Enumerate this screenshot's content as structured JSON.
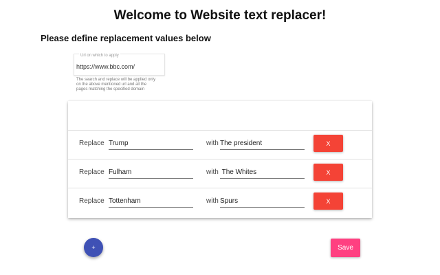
{
  "header": {
    "title": "Welcome to Website text replacer!",
    "subtitle": "Please define replacement values below"
  },
  "url_settings": {
    "label": "Url on which to apply",
    "value": "https://www.bbc.com/",
    "help_text": "The search and replace will be applied only on the above mentioned url and all the pages matching the specified domain"
  },
  "rules": [
    {
      "replace_label": "Replace",
      "search": "Trump",
      "with_label": "with",
      "replacement": "The president",
      "delete_label": "X"
    },
    {
      "replace_label": "Replace",
      "search": "Fulham",
      "with_label": "with",
      "replacement": " The Whites",
      "delete_label": "X"
    },
    {
      "replace_label": "Replace",
      "search": "Tottenham",
      "with_label": "with",
      "replacement": "Spurs",
      "delete_label": "X"
    }
  ],
  "actions": {
    "add_label": "+",
    "save_label": "Save"
  },
  "colors": {
    "delete_button": "#f44336",
    "add_button": "#3f51b5",
    "save_button": "#ff4081"
  },
  "icons": {
    "add": "plus-icon"
  }
}
